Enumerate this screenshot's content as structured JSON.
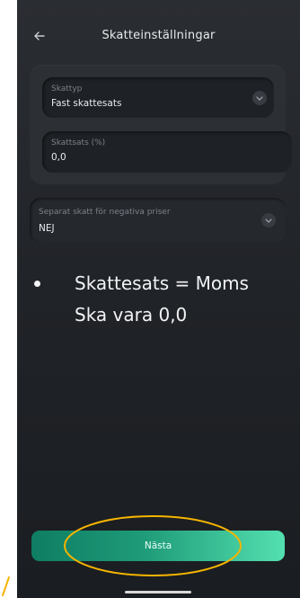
{
  "header": {
    "title": "Skatteinställningar",
    "back_icon": "arrow-left-icon"
  },
  "tax_card": {
    "tax_type": {
      "label": "Skattyp",
      "value": "Fast skattesats",
      "icon": "chevron-down-icon"
    },
    "tax_rate": {
      "label": "Skattsats (%)",
      "value": "0,0"
    }
  },
  "negative_prices": {
    "label": "Separat skatt för negativa priser",
    "value": "NEJ",
    "icon": "chevron-down-icon"
  },
  "annotation": {
    "line1": "Skattesats = Moms",
    "line2": "Ska vara 0,0"
  },
  "footer": {
    "next_label": "Nästa"
  },
  "colors": {
    "background": "#202327",
    "accent_start": "#0f7d63",
    "accent_end": "#54e0b0",
    "highlight_ellipse": "#f5b400"
  }
}
